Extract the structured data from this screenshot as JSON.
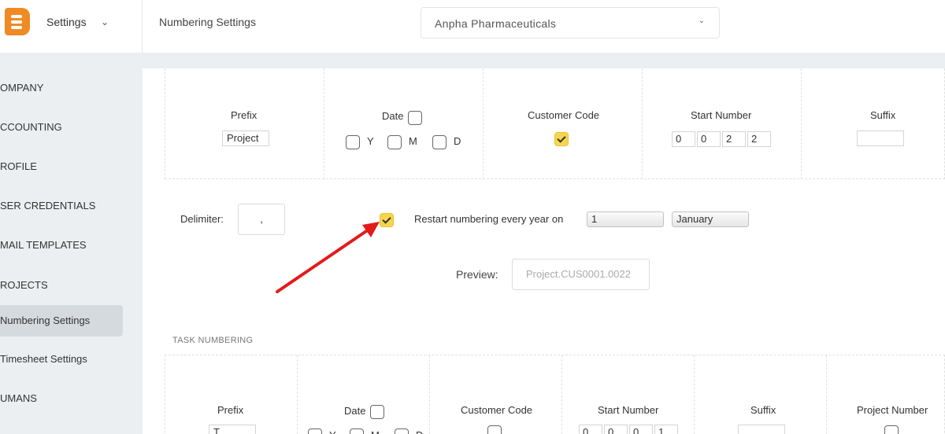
{
  "sidebar": {
    "title": "Settings",
    "items": [
      {
        "label": "OMPANY"
      },
      {
        "label": "CCOUNTING"
      },
      {
        "label": "ROFILE"
      },
      {
        "label": "SER CREDENTIALS"
      },
      {
        "label": "MAIL TEMPLATES"
      },
      {
        "label": "ROJECTS"
      },
      {
        "label": "Numbering Settings"
      },
      {
        "label": "Timesheet Settings"
      },
      {
        "label": "UMANS"
      }
    ]
  },
  "header": {
    "page_title": "Numbering Settings",
    "company": "Anpha Pharmaceuticals"
  },
  "project_numbering": {
    "prefix_label": "Prefix",
    "prefix_value": "Project",
    "date_label": "Date",
    "date_checked": false,
    "date_parts": [
      {
        "label": "Y",
        "checked": false
      },
      {
        "label": "M",
        "checked": false
      },
      {
        "label": "D",
        "checked": false
      }
    ],
    "customer_code_label": "Customer Code",
    "customer_code_checked": true,
    "start_number_label": "Start Number",
    "start_digits": [
      "0",
      "0",
      "2",
      "2"
    ],
    "suffix_label": "Suffix",
    "suffix_value": "",
    "delimiter_label": "Delimiter:",
    "delimiter_value": ",",
    "restart_checked": true,
    "restart_label": "Restart numbering every year on",
    "restart_day": "1",
    "restart_month": "January",
    "preview_label": "Preview:",
    "preview_value": "Project.CUS0001.0022"
  },
  "task_numbering": {
    "section_title": "TASK NUMBERING",
    "prefix_label": "Prefix",
    "prefix_value": "T",
    "date_label": "Date",
    "date_parts": [
      {
        "label": "Y"
      },
      {
        "label": "M"
      },
      {
        "label": "D"
      }
    ],
    "customer_code_label": "Customer Code",
    "start_number_label": "Start Number",
    "start_digits": [
      "0",
      "0",
      "0",
      "1"
    ],
    "suffix_label": "Suffix",
    "project_number_label": "Project Number"
  },
  "colors": {
    "accent_check": "#f7d54d",
    "logo": "#f08a24",
    "annotation_arrow": "#e31b1b"
  }
}
